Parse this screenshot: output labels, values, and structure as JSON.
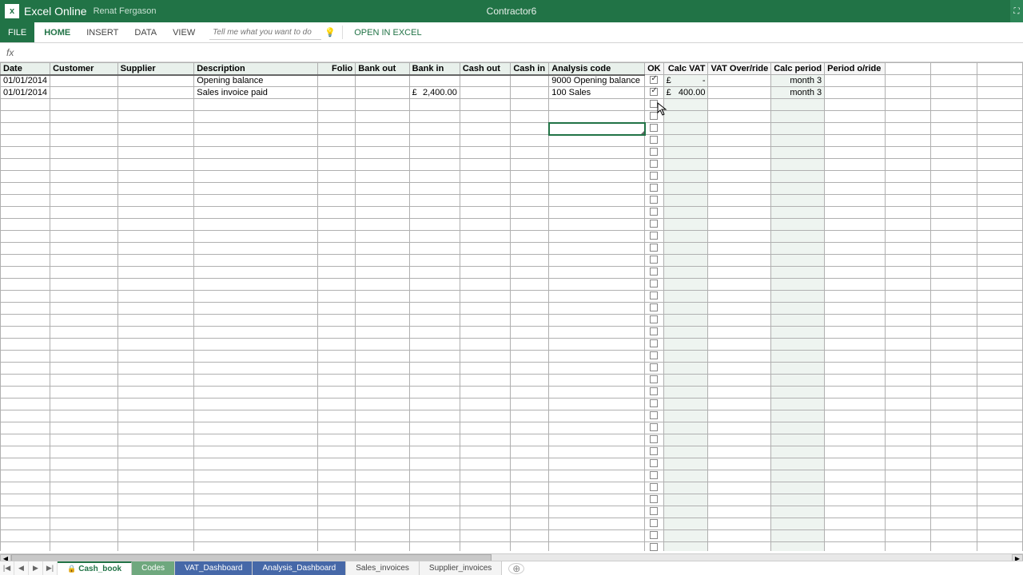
{
  "titlebar": {
    "app_name": "Excel Online",
    "user_name": "Renat Fergason",
    "doc_name": "Contractor6"
  },
  "ribbon": {
    "tabs": [
      "FILE",
      "HOME",
      "INSERT",
      "DATA",
      "VIEW"
    ],
    "tellme_placeholder": "Tell me what you want to do",
    "open_in_excel": "OPEN IN EXCEL"
  },
  "columns": {
    "date": "Date",
    "customer": "Customer",
    "supplier": "Supplier",
    "description": "Description",
    "folio": "Folio",
    "bank_out": "Bank out",
    "bank_in": "Bank in",
    "cash_out": "Cash out",
    "cash_in": "Cash in",
    "analysis": "Analysis code",
    "ok": "OK",
    "calc_vat": "Calc VAT",
    "vat_override": "VAT Over/ride",
    "calc_period": "Calc period",
    "period_override": "Period o/ride"
  },
  "rows": [
    {
      "date": "01/01/2014",
      "customer": "",
      "supplier": "",
      "description": "Opening balance",
      "folio": "",
      "bank_out": "",
      "bank_in": "",
      "cash_out": "",
      "cash_in": "",
      "analysis": "9000 Opening balance",
      "ok": true,
      "calc_vat_cur": "£",
      "calc_vat": "-",
      "vat_override": "",
      "calc_period": "month 3",
      "period_override": ""
    },
    {
      "date": "01/01/2014",
      "customer": "",
      "supplier": "",
      "description": "Sales invoice paid",
      "folio": "",
      "bank_out": "",
      "bank_in_cur": "£",
      "bank_in": "2,400.00",
      "cash_out": "",
      "cash_in": "",
      "analysis": "100 Sales",
      "ok": true,
      "calc_vat_cur": "£",
      "calc_vat": "400.00",
      "vat_override": "",
      "calc_period": "month 3",
      "period_override": ""
    }
  ],
  "sheet_tabs": {
    "nav": [
      "|◀",
      "◀",
      "▶",
      "▶|"
    ],
    "tabs": [
      {
        "label": "Cash_book",
        "style": "active",
        "locked": true
      },
      {
        "label": "Codes",
        "style": "green",
        "locked": false
      },
      {
        "label": "VAT_Dashboard",
        "style": "blue",
        "locked": false
      },
      {
        "label": "Analysis_Dashboard",
        "style": "blue",
        "locked": false
      },
      {
        "label": "Sales_invoices",
        "style": "",
        "locked": false
      },
      {
        "label": "Supplier_invoices",
        "style": "",
        "locked": false
      }
    ]
  }
}
